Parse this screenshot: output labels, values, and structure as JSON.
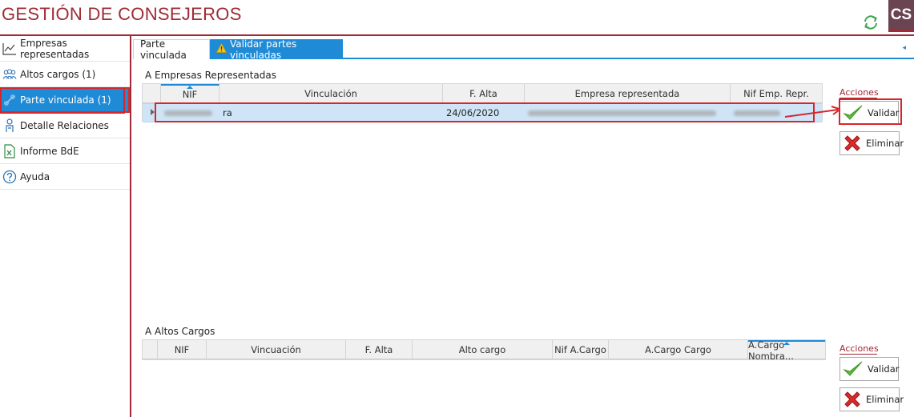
{
  "app": {
    "title": "GESTIÓN DE CONSEJEROS",
    "avatar_initials": "CS",
    "brand_color": "#a02a35",
    "accent_color": "#1f8bd6"
  },
  "sidebar": {
    "items": [
      {
        "label": "Empresas representadas",
        "icon": "chart-icon",
        "active": false
      },
      {
        "label": "Altos cargos (1)",
        "icon": "users-icon",
        "active": false
      },
      {
        "label": "Parte vinculada (1)",
        "icon": "link-icon",
        "active": true
      },
      {
        "label": "Detalle Relaciones",
        "icon": "person-icon",
        "active": false
      },
      {
        "label": "Informe BdE",
        "icon": "excel-icon",
        "active": false
      },
      {
        "label": "Ayuda",
        "icon": "help-icon",
        "active": false
      }
    ]
  },
  "tabs": [
    {
      "label": "Parte vinculada",
      "active": false
    },
    {
      "label": "Validar partes vinculadas",
      "active": true,
      "icon": "warning-icon"
    }
  ],
  "empresas": {
    "section_label": "A Empresas Representadas",
    "columns": [
      "NIF",
      "Vinculación",
      "F. Alta",
      "Empresa representada",
      "Nif Emp. Repr."
    ],
    "rows": [
      {
        "nif": "",
        "vinculacion": "ra",
        "f_alta": "24/06/2020",
        "empresa": "",
        "nif_emp": ""
      }
    ]
  },
  "altos": {
    "section_label": "A Altos Cargos",
    "columns": [
      "NIF",
      "Vincuación",
      "F. Alta",
      "Alto cargo",
      "Nif A.Cargo",
      "A.Cargo Cargo",
      "A.Cargo Nombra..."
    ]
  },
  "actions": {
    "label": "Acciones",
    "validar": "Validar",
    "eliminar": "Eliminar"
  }
}
